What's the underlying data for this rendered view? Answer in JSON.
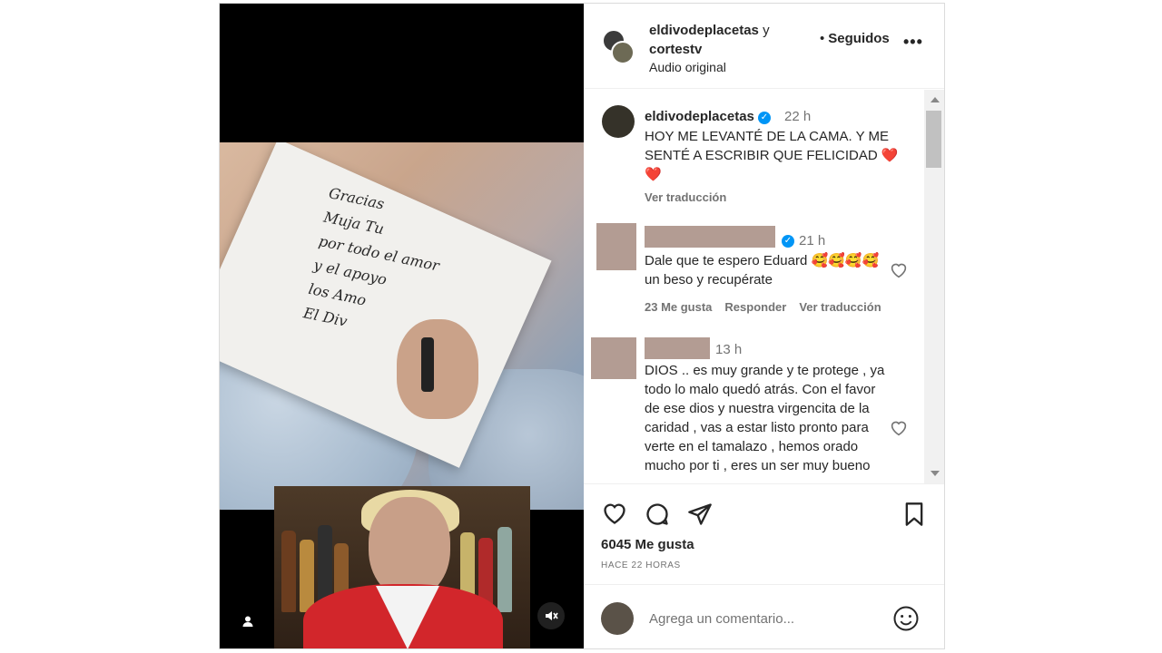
{
  "header": {
    "username": "eldivodeplacetas",
    "connector": "y",
    "collaborator": "cortestv",
    "audio_label": "Audio original",
    "follow_dot": "•",
    "follow_label": "Seguidos",
    "more_label": "•••"
  },
  "media": {
    "handwriting": [
      "Gracias",
      "Muja Tu",
      "por todo el amor",
      "y el apoyo",
      "los Amo",
      "El Div"
    ]
  },
  "caption": {
    "username": "eldivodeplacetas",
    "time": "22 h",
    "text": "HOY ME LEVANTÉ DE LA CAMA. Y ME SENTÉ A ESCRIBIR QUE FELICIDAD",
    "hearts": "❤️ ❤️",
    "translate": "Ver traducción"
  },
  "comments": [
    {
      "time": "21 h",
      "text": "Dale que te espero Eduard 🥰🥰🥰🥰 un beso y recupérate",
      "likes": "23 Me gusta",
      "reply": "Responder",
      "translate": "Ver traducción"
    },
    {
      "time": "13 h",
      "text": "DIOS .. es muy grande y te protege , ya todo lo malo quedó atrás. Con el favor de ese dios y nuestra virgencita de la caridad , vas a estar listo pronto para verte en el tamalazo , hemos orado mucho por ti , eres un ser muy bueno"
    }
  ],
  "footer": {
    "likes": "6045 Me gusta",
    "ago": "HACE 22 HORAS",
    "comment_placeholder": "Agrega un comentario..."
  },
  "colors": {
    "verified": "#0095f6",
    "text": "#262626",
    "muted": "#737373",
    "redaction": "#b39c93"
  }
}
